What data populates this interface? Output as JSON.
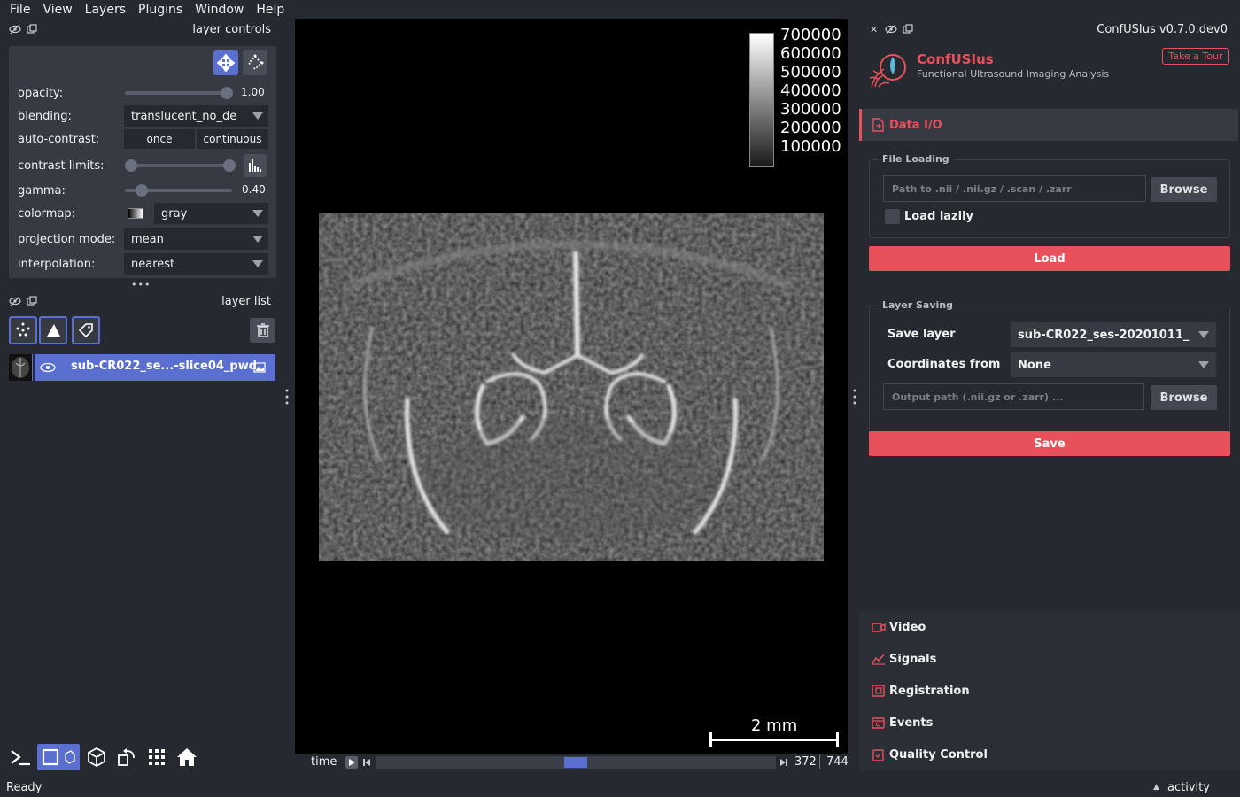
{
  "menu": [
    "File",
    "View",
    "Layers",
    "Plugins",
    "Window",
    "Help"
  ],
  "layer_controls": {
    "title": "layer controls",
    "opacity_label": "opacity:",
    "opacity_value": "1.00",
    "opacity_level": 1.0,
    "blending_label": "blending:",
    "blending_value": "translucent_no_de",
    "autocontrast_label": "auto-contrast:",
    "autocontrast_once": "once",
    "autocontrast_continuous": "continuous",
    "contrast_label": "contrast limits:",
    "gamma_label": "gamma:",
    "gamma_value": "0.40",
    "colormap_label": "colormap:",
    "colormap_value": "gray",
    "projection_label": "projection mode:",
    "projection_value": "mean",
    "interpolation_label": "interpolation:",
    "interpolation_value": "nearest",
    "more": "•••"
  },
  "layer_list": {
    "title": "layer list",
    "layers": [
      {
        "name": "sub-CR022_se...-slice04_pwd"
      }
    ]
  },
  "canvas": {
    "colorbar_ticks": [
      "700000",
      "600000",
      "500000",
      "400000",
      "300000",
      "200000",
      "100000"
    ],
    "scalebar": "2 mm"
  },
  "dims": {
    "axis_label": "time",
    "current": "372",
    "total": "744",
    "position": 0.5
  },
  "right": {
    "version": "ConfUSIus v0.7.0.dev0",
    "app_name": "ConfUSIus",
    "app_subtitle": "Functional Ultrasound Imaging Analysis",
    "tour_button": "Take a Tour",
    "data_io": "Data I/O",
    "file_loading": "File Loading",
    "path_placeholder": "Path to .nii / .nii.gz / .scan / .zarr",
    "browse": "Browse",
    "load_lazily": "Load lazily",
    "load": "Load",
    "layer_saving": "Layer Saving",
    "save_layer_label": "Save layer",
    "save_layer_value": "sub-CR022_ses-20201011_",
    "coords_label": "Coordinates from",
    "coords_value": "None",
    "output_placeholder": "Output path (.nii.gz or .zarr) ...",
    "save": "Save",
    "sections": [
      "Video",
      "Signals",
      "Registration",
      "Events",
      "Quality Control"
    ]
  },
  "status": {
    "text": "Ready",
    "activity": "activity"
  },
  "colors": {
    "accent_red": "#e8505b",
    "selection_blue": "#5a6fd0",
    "bg": "#262930",
    "panel": "#373a42"
  }
}
